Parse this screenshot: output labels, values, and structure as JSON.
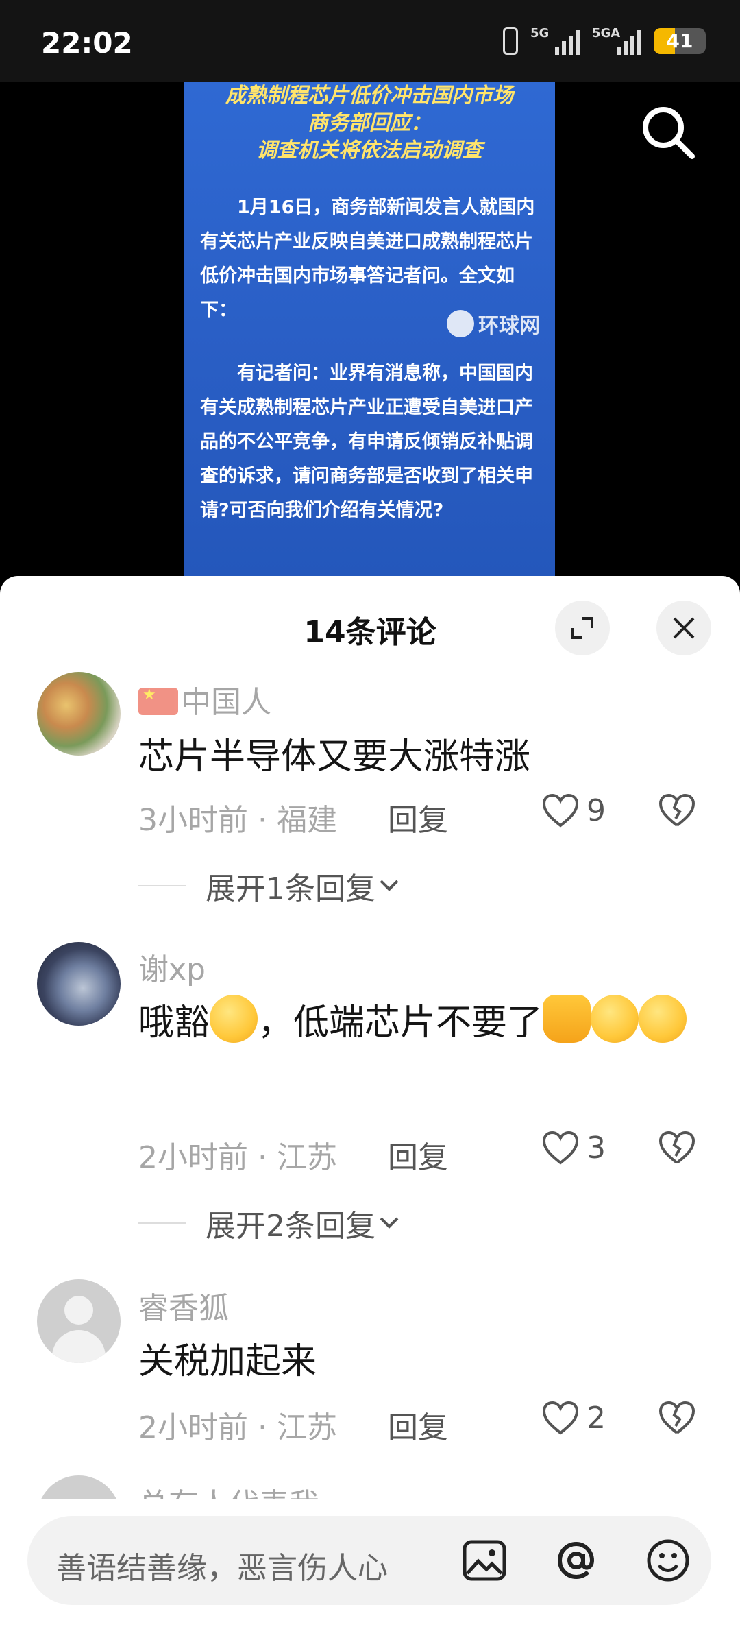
{
  "status_bar": {
    "time": "22:02",
    "network1": "5G",
    "network2": "5GA",
    "battery": "41",
    "battery_level": 0.41
  },
  "video": {
    "headline_lines": [
      "成熟制程芯片低价冲击国内市场",
      "商务部回应：",
      "调查机关将依法启动调查"
    ],
    "paragraph1": "1月16日，商务部新闻发言人就国内有关芯片产业反映自美进口成熟制程芯片低价冲击国内市场事答记者问。全文如下：",
    "paragraph2": "有记者问：业界有消息称，中国国内有关成熟制程芯片产业正遭受自美进口产品的不公平竞争，有申请反倾销反补贴调查的诉求，请问商务部是否收到了相关申请?可否向我们介绍有关情况?",
    "watermark": "环球网"
  },
  "sheet": {
    "title": "14条评论"
  },
  "comments": [
    {
      "username": "中国人",
      "text": "芯片半导体又要大涨特涨",
      "meta": "3小时前 · 福建",
      "reply": "回复",
      "likes": "9",
      "expand": "展开1条回复"
    },
    {
      "username": "谢xp",
      "text_a": "哦豁",
      "text_b": "，低端芯片不要了",
      "meta": "2小时前 · 江苏",
      "reply": "回复",
      "likes": "3",
      "expand": "展开2条回复"
    },
    {
      "username": "睿香狐",
      "text": "关税加起来",
      "meta": "2小时前 · 江苏",
      "reply": "回复",
      "likes": "2"
    },
    {
      "username": "总有人代表我"
    }
  ],
  "input": {
    "placeholder": "善语结善缘，恶言伤人心"
  },
  "colors": {
    "card_blue": "#2a5fc6",
    "headline_yellow": "#ffe46b",
    "battery": "#f5b800"
  }
}
